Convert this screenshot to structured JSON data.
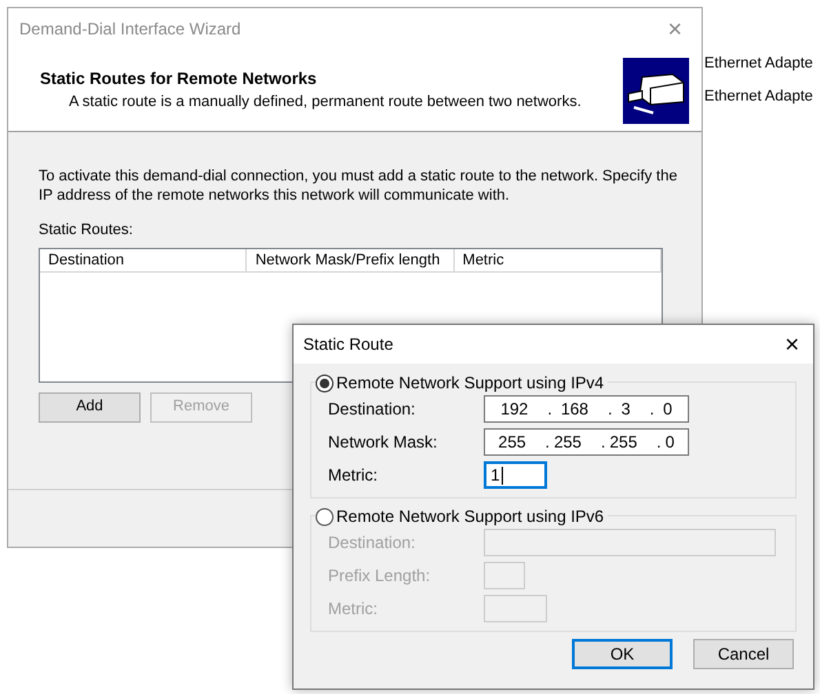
{
  "background": {
    "items": [
      "Ethernet Adapte",
      "Ethernet Adapte"
    ]
  },
  "wizard": {
    "title": "Demand-Dial Interface Wizard",
    "close": "×",
    "header_title": "Static Routes for Remote Networks",
    "header_subtitle": "A static route is a manually defined, permanent route between two networks.",
    "instructions": "To activate this demand-dial connection, you must add a static route to the network. Specify the IP address of the remote networks this network will communicate with.",
    "list_label": "Static Routes:",
    "columns": [
      "Destination",
      "Network Mask/Prefix length",
      "Metric"
    ],
    "buttons": [
      {
        "label": "Add",
        "disabled": false
      },
      {
        "label": "Remove",
        "disabled": true
      }
    ]
  },
  "dialog": {
    "title": "Static Route",
    "close": "×",
    "separator": ".",
    "groups": [
      {
        "label": "Remote Network Support using IPv4",
        "selected": true,
        "disabled": false,
        "fields": [
          {
            "kind": "ip",
            "label": "Destination:",
            "octets": [
              "192",
              "168",
              "3",
              "0"
            ],
            "focused": false
          },
          {
            "kind": "ip",
            "label": "Network Mask:",
            "octets": [
              "255",
              "255",
              "255",
              "0"
            ],
            "focused": false
          },
          {
            "kind": "small",
            "label": "Metric:",
            "value": "1",
            "focused": true
          }
        ]
      },
      {
        "label": "Remote Network Support using IPv6",
        "selected": false,
        "disabled": true,
        "fields": [
          {
            "kind": "wide",
            "label": "Destination:",
            "focused": false
          },
          {
            "kind": "tiny",
            "label": "Prefix Length:",
            "focused": false
          },
          {
            "kind": "small",
            "label": "Metric:",
            "focused": false
          }
        ]
      }
    ],
    "buttons": [
      {
        "label": "OK",
        "default": true
      },
      {
        "label": "Cancel",
        "default": false
      }
    ]
  }
}
